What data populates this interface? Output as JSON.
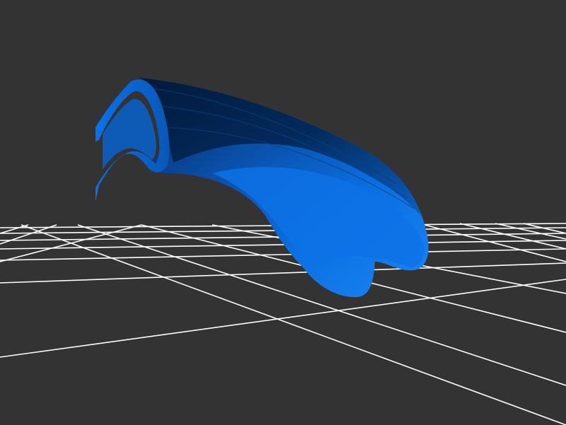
{
  "viewer": {
    "background_color": "#333333",
    "ground_grid": {
      "visible": true,
      "line_color": "#ffffff"
    },
    "model": {
      "shape": "curved swept tube with wavy cross-section",
      "primary_color": "#0a6fe0",
      "highlight_color": "#2a8cff",
      "shadow_color": "#02254f"
    }
  }
}
